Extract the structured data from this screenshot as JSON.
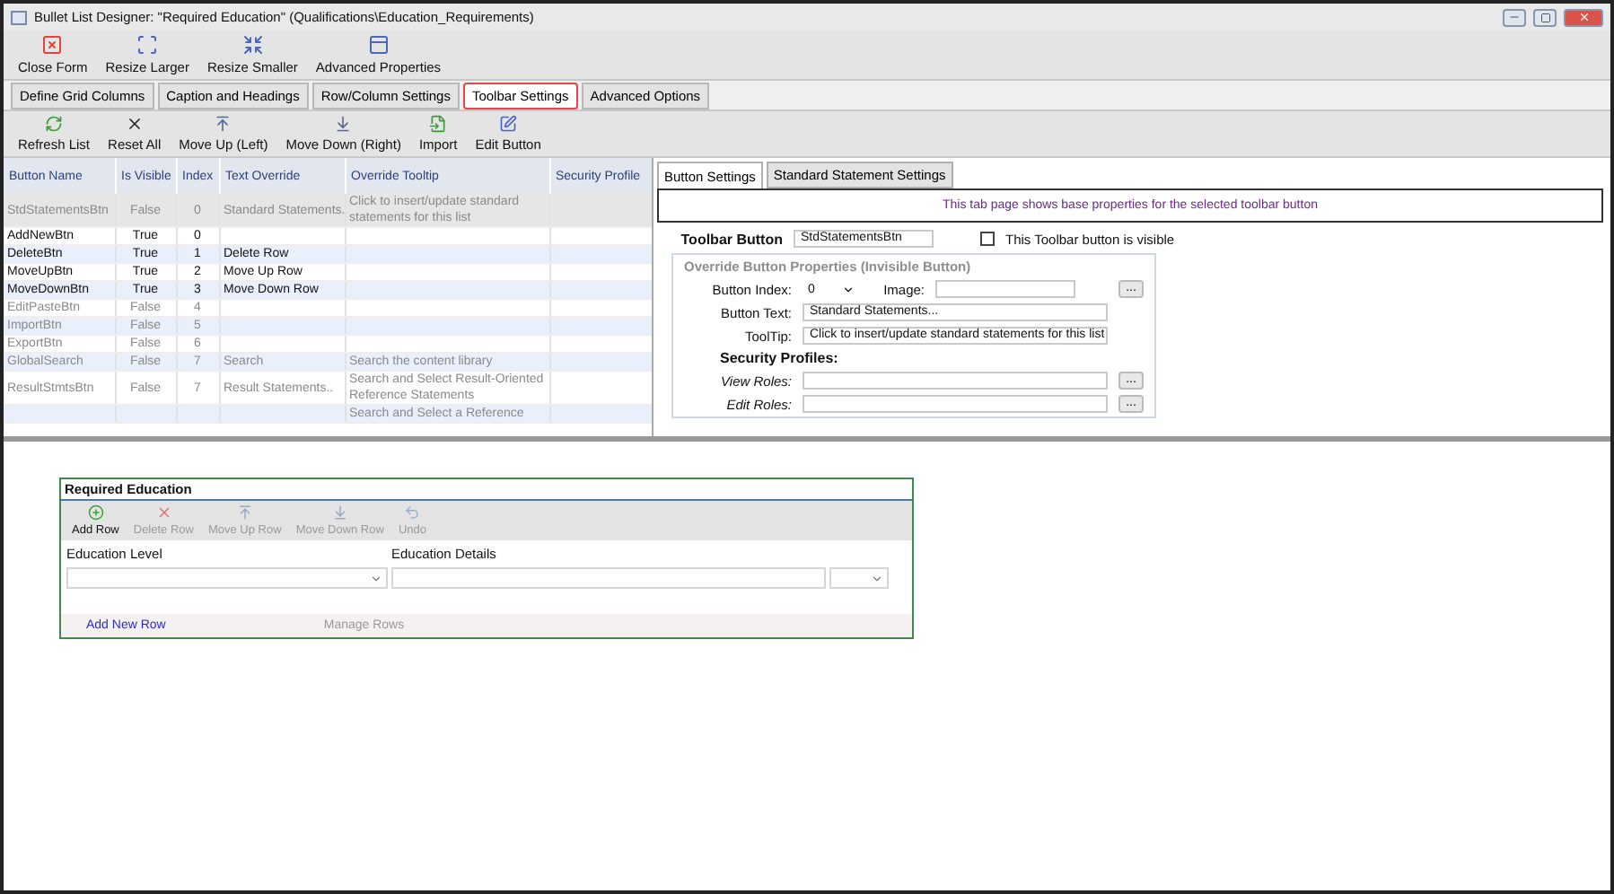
{
  "window": {
    "title": "Bullet List Designer: \"Required Education\" (Qualifications\\Education_Requirements)"
  },
  "main_toolbar": [
    {
      "label": "Close Form",
      "kind": "close"
    },
    {
      "label": "Resize Larger",
      "kind": "larger"
    },
    {
      "label": "Resize Smaller",
      "kind": "smaller"
    },
    {
      "label": "Advanced Properties",
      "kind": "properties"
    }
  ],
  "tabs": [
    {
      "label": "Define Grid Columns",
      "selected": false
    },
    {
      "label": "Caption and Headings",
      "selected": false
    },
    {
      "label": "Row/Column Settings",
      "selected": false
    },
    {
      "label": "Toolbar Settings",
      "selected": true
    },
    {
      "label": "Advanced Options",
      "selected": false
    }
  ],
  "sub_toolbar": [
    {
      "label": "Refresh List",
      "kind": "refresh"
    },
    {
      "label": "Reset All",
      "kind": "reset"
    },
    {
      "label": "Move Up (Left)",
      "kind": "up"
    },
    {
      "label": "Move Down (Right)",
      "kind": "down"
    },
    {
      "label": "Import",
      "kind": "import"
    },
    {
      "label": "Edit Button",
      "kind": "edit"
    }
  ],
  "grid": {
    "columns": [
      "Button Name",
      "Is Visible",
      "Index",
      "Text Override",
      "Override Tooltip",
      "Security Profile"
    ],
    "rows": [
      {
        "cells": [
          "StdStatementsBtn",
          "False",
          "0",
          "Standard Statements.",
          "Click to insert/update standard statements for this list",
          ""
        ],
        "dimmed": true,
        "selected": true
      },
      {
        "cells": [
          "AddNewBtn",
          "True",
          "0",
          "",
          "",
          ""
        ],
        "dimmed": false,
        "selected": false
      },
      {
        "cells": [
          "DeleteBtn",
          "True",
          "1",
          "Delete Row",
          "",
          ""
        ],
        "dimmed": false,
        "selected": false
      },
      {
        "cells": [
          "MoveUpBtn",
          "True",
          "2",
          "Move Up Row",
          "",
          ""
        ],
        "dimmed": false,
        "selected": false
      },
      {
        "cells": [
          "MoveDownBtn",
          "True",
          "3",
          "Move Down Row",
          "",
          ""
        ],
        "dimmed": false,
        "selected": false
      },
      {
        "cells": [
          "EditPasteBtn",
          "False",
          "4",
          "",
          "",
          ""
        ],
        "dimmed": true,
        "selected": false
      },
      {
        "cells": [
          "ImportBtn",
          "False",
          "5",
          "",
          "",
          ""
        ],
        "dimmed": true,
        "selected": false
      },
      {
        "cells": [
          "ExportBtn",
          "False",
          "6",
          "",
          "",
          ""
        ],
        "dimmed": true,
        "selected": false
      },
      {
        "cells": [
          "GlobalSearch",
          "False",
          "7",
          "Search",
          "Search the content library",
          ""
        ],
        "dimmed": true,
        "selected": false
      },
      {
        "cells": [
          "ResultStmtsBtn",
          "False",
          "7",
          "Result Statements..",
          "Search and Select Result-Oriented Reference Statements",
          ""
        ],
        "dimmed": true,
        "selected": false
      },
      {
        "cells": [
          "",
          "",
          "",
          "",
          "Search and Select a Reference",
          ""
        ],
        "dimmed": true,
        "selected": false
      }
    ]
  },
  "detail_tabs": [
    {
      "label": "Button Settings",
      "selected": true
    },
    {
      "label": "Standard Statement Settings",
      "selected": false
    }
  ],
  "info": "This tab page shows base properties for the selected toolbar button",
  "toolbar_button": {
    "label": "Toolbar Button",
    "value": "StdStatementsBtn"
  },
  "visible_checkbox": {
    "label": "This Toolbar button is visible",
    "checked": false
  },
  "override_group": {
    "title": "Override Button Properties  (Invisible Button)",
    "button_index": {
      "label": "Button Index:",
      "value": "0"
    },
    "image": {
      "label": "Image:",
      "button": "..."
    },
    "button_text": {
      "label": "Button Text:",
      "value": "Standard Statements..."
    },
    "tooltip": {
      "label": "ToolTip:",
      "value": "Click to insert/update standard statements for this list"
    },
    "security_title": "Security Profiles:",
    "roles": [
      {
        "label": "View Roles:",
        "button": "..."
      },
      {
        "label": "Edit Roles:",
        "button": "..."
      }
    ]
  },
  "preview": {
    "title": "Required Education",
    "toolbar": [
      {
        "label": "Add Row",
        "kind": "add",
        "disabled": false
      },
      {
        "label": "Delete Row",
        "kind": "delete",
        "disabled": true
      },
      {
        "label": "Move Up Row",
        "kind": "up",
        "disabled": true
      },
      {
        "label": "Move Down Row",
        "kind": "down",
        "disabled": true
      },
      {
        "label": "Undo",
        "kind": "undo",
        "disabled": true
      }
    ],
    "columns": [
      "Education Level",
      "Education Details"
    ],
    "footer": {
      "add_link": "Add New Row",
      "manage": "Manage Rows"
    }
  }
}
